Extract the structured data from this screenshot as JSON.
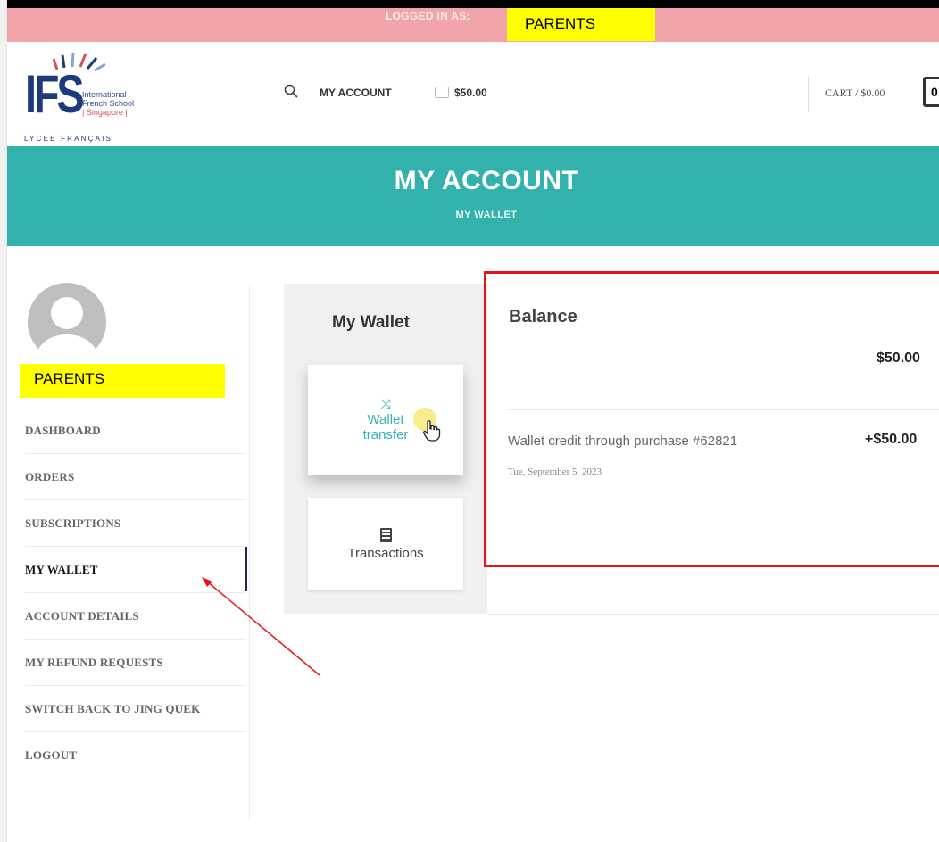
{
  "topbar": {
    "logged_in_label": "LOGGED IN AS:",
    "user_name": "PARENTS"
  },
  "header": {
    "logo": {
      "letters": "IFS",
      "line1": "International",
      "line2": "French School",
      "line3": "| Singapore |",
      "subtitle": "LYCÉE FRANÇAIS"
    },
    "search_icon": "search-icon",
    "nav_account": "MY ACCOUNT",
    "wallet_icon": "wallet-icon",
    "nav_wallet_balance": "$50.00",
    "cart_label": "CART / $0.00",
    "cart_count": "0"
  },
  "banner": {
    "title": "MY ACCOUNT",
    "subtitle": "MY WALLET",
    "color": "#33b1ad"
  },
  "sidebar": {
    "user_name": "PARENTS",
    "items": [
      {
        "label": "DASHBOARD"
      },
      {
        "label": "ORDERS"
      },
      {
        "label": "SUBSCRIPTIONS"
      },
      {
        "label": "MY WALLET",
        "active": true
      },
      {
        "label": "ACCOUNT DETAILS"
      },
      {
        "label": "MY REFUND REQUESTS"
      },
      {
        "label": "SWITCH BACK TO JING QUEK"
      },
      {
        "label": "LOGOUT"
      }
    ]
  },
  "wallet": {
    "heading": "My Wallet",
    "tiles": [
      {
        "icon": "shuffle-icon",
        "label": "Wallet transfer"
      },
      {
        "icon": "list-icon",
        "label": "Transactions"
      }
    ]
  },
  "balance": {
    "title": "Balance",
    "amount": "$50.00",
    "transactions": [
      {
        "description": "Wallet credit through purchase #62821",
        "amount": "+$50.00",
        "date": "Tue, September 5, 2023"
      }
    ]
  },
  "colors": {
    "accent": "#33b1ad",
    "topbar": "#f1a5ab",
    "highlight_yellow": "#ffff00",
    "annotation_red": "#e8121a"
  }
}
